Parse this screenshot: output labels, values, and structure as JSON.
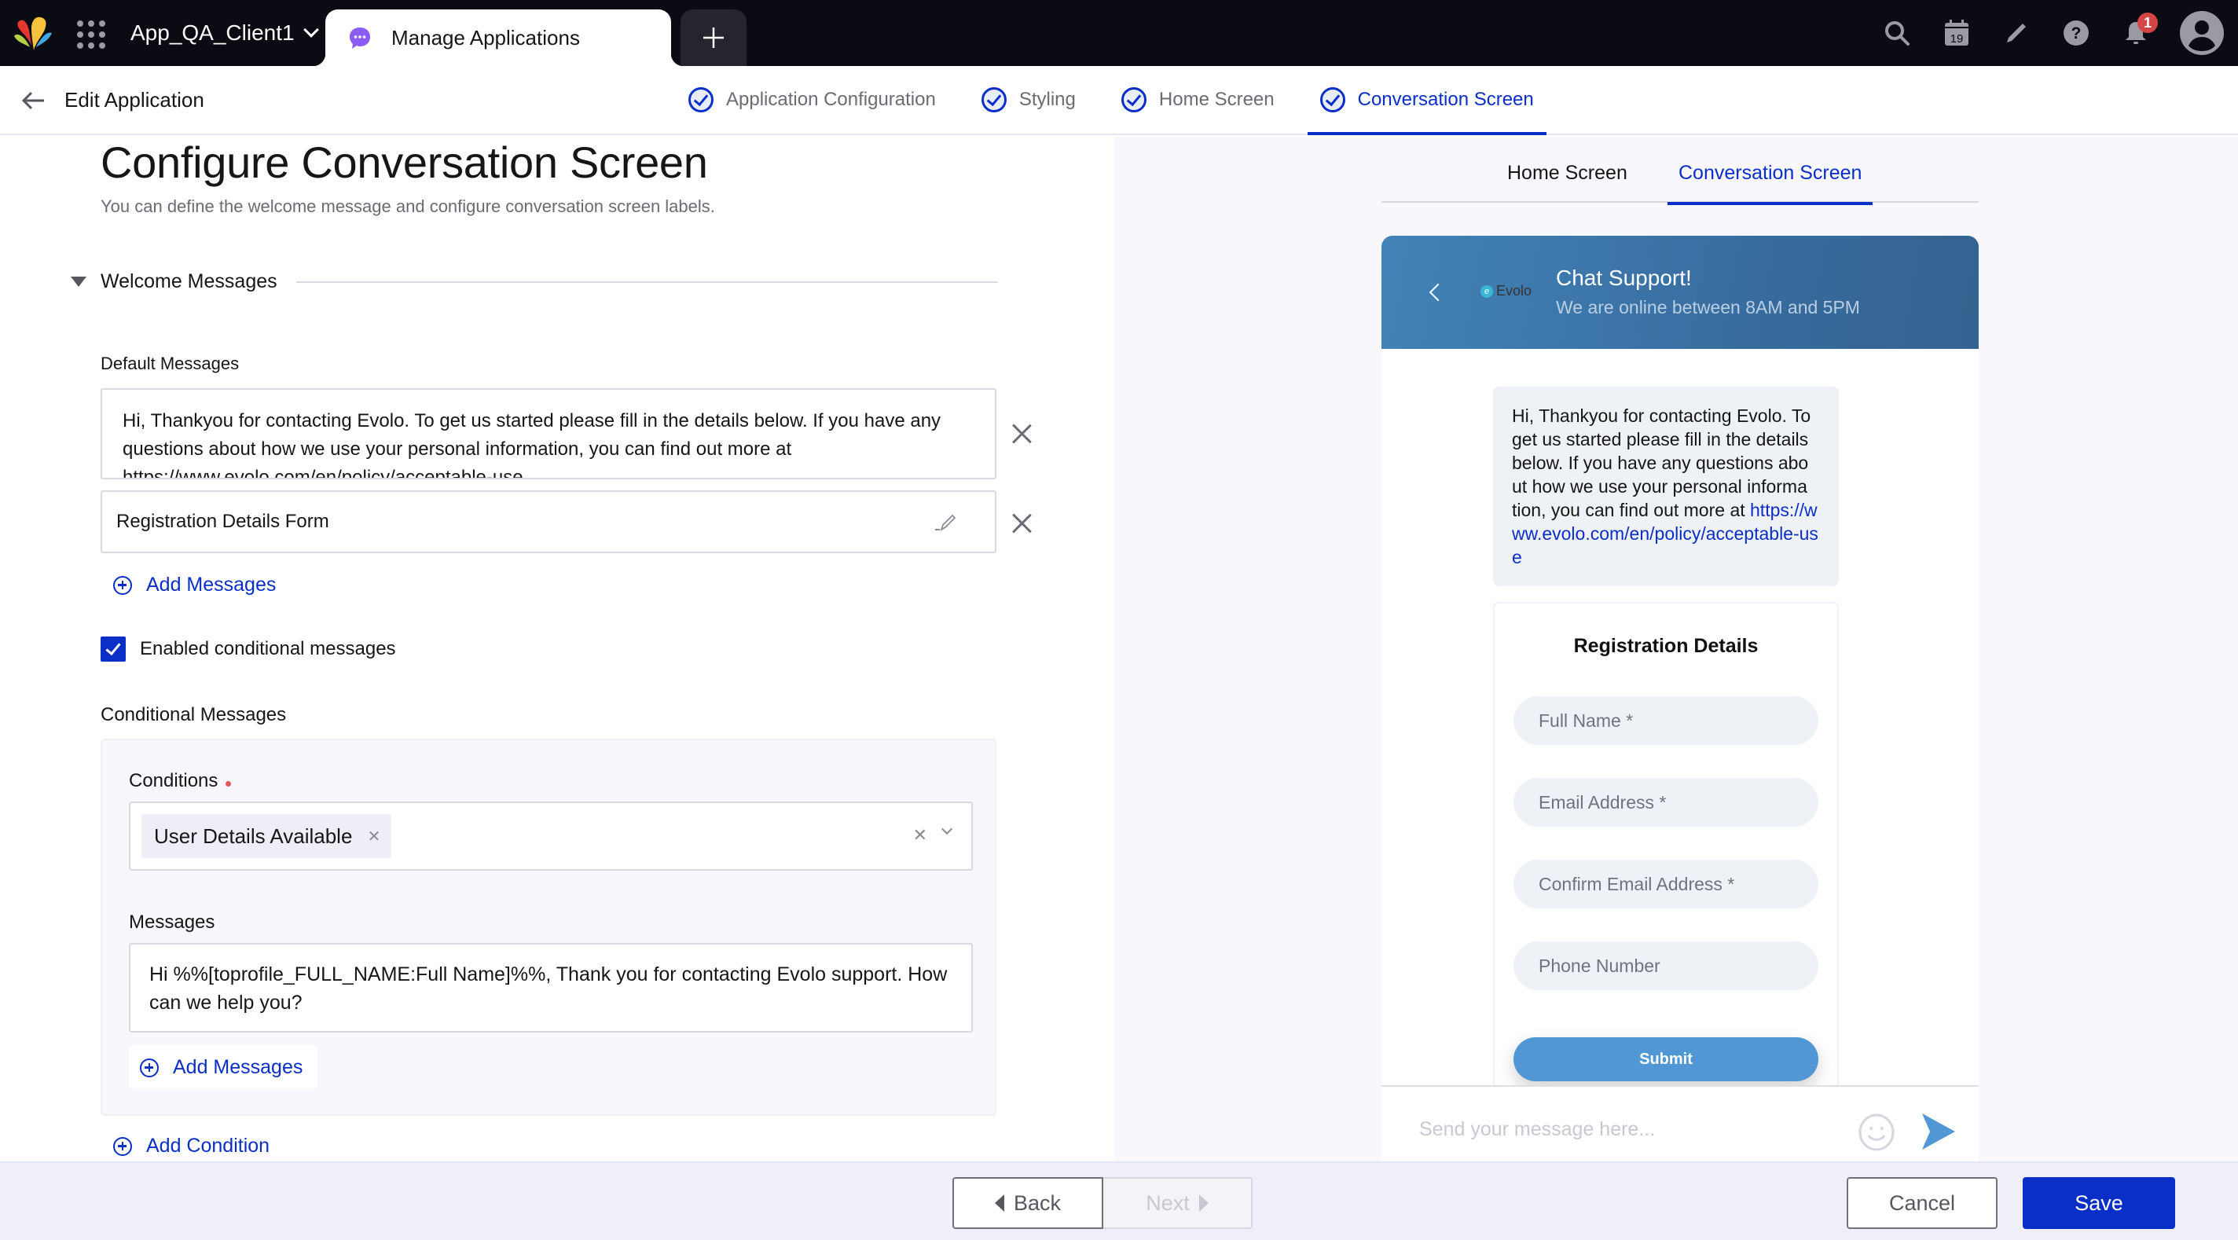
{
  "topbar": {
    "client_name": "App_QA_Client1",
    "active_tab_label": "Manage Applications",
    "notification_count": "1",
    "calendar_day": "19",
    "icons": [
      "search-icon",
      "calendar-icon",
      "pencil-icon",
      "help-icon",
      "bell-icon",
      "user-avatar-icon"
    ]
  },
  "subheader": {
    "title": "Edit Application",
    "steps": [
      {
        "label": "Application Configuration",
        "completed": true,
        "active": false
      },
      {
        "label": "Styling",
        "completed": true,
        "active": false
      },
      {
        "label": "Home Screen",
        "completed": true,
        "active": false
      },
      {
        "label": "Conversation Screen",
        "completed": true,
        "active": true
      }
    ]
  },
  "main": {
    "title": "Configure Conversation Screen",
    "subtitle": "You can define the welcome message and configure conversation screen labels.",
    "welcome_section": {
      "label": "Welcome Messages",
      "expanded": true,
      "default_messages_label": "Default Messages",
      "default_messages": [
        {
          "type": "text",
          "value": "Hi, Thankyou for contacting Evolo. To get us started please fill in the details below. If you have any questions about how we use your personal information, you can find out more at https://www.evolo.com/en/policy/acceptable-use"
        },
        {
          "type": "form",
          "value": "Registration Details Form"
        }
      ],
      "add_messages_label": "Add Messages",
      "conditional_checkbox_label": "Enabled conditional messages",
      "conditional_enabled": true,
      "conditional_messages_label": "Conditional Messages",
      "conditions_label": "Conditions",
      "conditions_required": true,
      "selected_conditions": [
        "User Details Available"
      ],
      "messages_label": "Messages",
      "conditional_message": "Hi %%[toprofile_FULL_NAME:Full Name]%%, Thank you for contacting Evolo support. How can we help you?",
      "inner_add_messages_label": "Add Messages",
      "add_condition_label": "Add Condition"
    }
  },
  "preview": {
    "tabs": [
      {
        "label": "Home Screen",
        "active": false
      },
      {
        "label": "Conversation Screen",
        "active": true
      }
    ],
    "header_title": "Chat Support!",
    "header_subtitle": "We are online between 8AM and 5PM",
    "brand_name": "Evolo",
    "bot_message_text": "Hi, Thankyou for contacting Evolo. To get us started please fill in the details below. If you have any questions abo ut how we use your personal informa tion, you can find out more at ",
    "bot_message_link": "https://www.evolo.com/en/policy/acceptable-use",
    "form_title": "Registration Details",
    "form_fields": [
      "Full Name *",
      "Email Address *",
      "Confirm Email Address *",
      "Phone Number"
    ],
    "submit_label": "Submit",
    "input_placeholder": "Send your message here..."
  },
  "footer": {
    "back_label": "Back",
    "next_label": "Next",
    "next_disabled": true,
    "cancel_label": "Cancel",
    "save_label": "Save"
  },
  "colors": {
    "accent": "#0a2fc6",
    "topbar_bg": "#0b0c13",
    "preview_header": "#3a72a8",
    "submit_button": "#5197d5",
    "badge": "#d64545",
    "tab_icon": "#8b5cf6"
  }
}
